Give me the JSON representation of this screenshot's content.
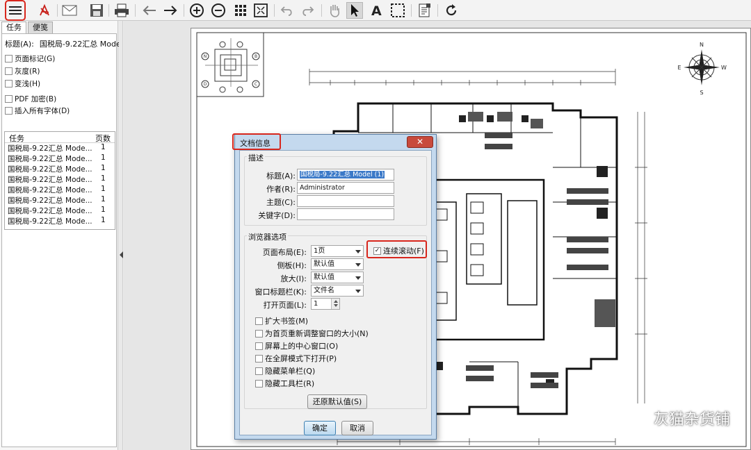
{
  "toolbar": {
    "items": [
      "menu-icon",
      "pdf-icon",
      "mail-icon",
      "save-icon",
      "print-icon",
      "back-arrow-icon",
      "forward-arrow-icon",
      "zoom-in-icon",
      "zoom-out-icon",
      "grid-icon",
      "fit-page-icon",
      "undo-icon",
      "redo-icon",
      "hand-tool-icon",
      "select-arrow-icon",
      "text-tool-icon",
      "marquee-select-icon",
      "document-properties-icon",
      "refresh-icon"
    ],
    "accent": "#d8261c"
  },
  "leftpanel": {
    "tabs": [
      {
        "label": "任务"
      },
      {
        "label": "便笺"
      }
    ],
    "title_label": "标题(A):",
    "title_value": "国税局-9.22汇总 Model",
    "options": [
      {
        "label": "页面标记(G)",
        "checked": false
      },
      {
        "label": "灰度(R)",
        "checked": false
      },
      {
        "label": "变浅(H)",
        "checked": false
      },
      {
        "label": "PDF 加密(B)",
        "checked": false
      },
      {
        "label": "插入所有字体(D)",
        "checked": false
      }
    ],
    "tasklist": {
      "col_task": "任务",
      "col_pages": "页数",
      "rows": [
        {
          "task": "国税局-9.22汇总 Mode...",
          "pages": "1"
        },
        {
          "task": "国税局-9.22汇总 Mode...",
          "pages": "1"
        },
        {
          "task": "国税局-9.22汇总 Mode...",
          "pages": "1"
        },
        {
          "task": "国税局-9.22汇总 Mode...",
          "pages": "1"
        },
        {
          "task": "国税局-9.22汇总 Mode...",
          "pages": "1"
        },
        {
          "task": "国税局-9.22汇总 Mode...",
          "pages": "1"
        },
        {
          "task": "国税局-9.22汇总 Mode...",
          "pages": "1"
        },
        {
          "task": "国税局-9.22汇总 Mode...",
          "pages": "1"
        }
      ]
    }
  },
  "drawing": {
    "compass": {
      "n": "N",
      "s": "S",
      "e": "E",
      "w": "W"
    },
    "key_plan_markers": [
      "N",
      "D",
      "B",
      "C"
    ]
  },
  "dialog": {
    "title": "文档信息",
    "close": "✕",
    "desc_group": "描述",
    "fields": [
      {
        "label": "标题(A):",
        "value": "国税局-9.22汇总 Model (1)"
      },
      {
        "label": "作者(R):",
        "value": "Administrator"
      },
      {
        "label": "主题(C):",
        "value": ""
      },
      {
        "label": "关键字(D):",
        "value": ""
      }
    ],
    "browser_group": "浏览器选项",
    "selects": [
      {
        "label": "页面布局(E):",
        "value": "1页"
      },
      {
        "label": "侧板(H):",
        "value": "默认值"
      },
      {
        "label": "放大(I):",
        "value": "默认值"
      },
      {
        "label": "窗口标题栏(K):",
        "value": "文件名"
      }
    ],
    "open_page_label": "打开页面(L):",
    "open_page_value": "1",
    "continuous_scroll": {
      "label": "连续滚动(F)",
      "checked": true
    },
    "checks": [
      {
        "label": "扩大书签(M)",
        "checked": false
      },
      {
        "label": "为首页重新调整窗口的大小(N)",
        "checked": false
      },
      {
        "label": "屏幕上的中心窗口(O)",
        "checked": false
      },
      {
        "label": "在全屏模式下打开(P)",
        "checked": false
      },
      {
        "label": "隐藏菜单栏(Q)",
        "checked": false
      },
      {
        "label": "隐藏工具栏(R)",
        "checked": false
      }
    ],
    "restore_defaults": "还原默认值(S)",
    "ok": "确定",
    "cancel": "取消"
  },
  "watermark": {
    "text": "灰猫杂货铺"
  }
}
